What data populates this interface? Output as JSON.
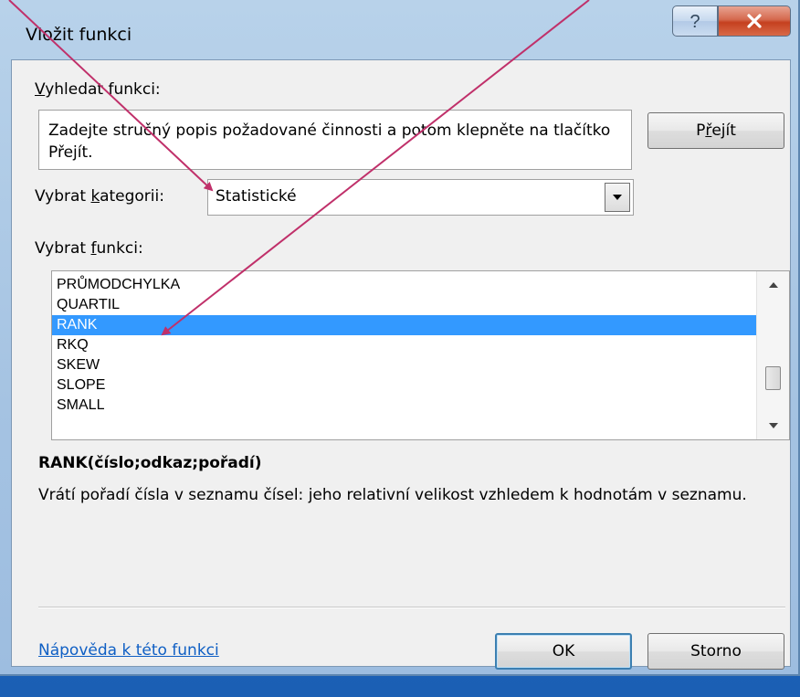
{
  "window": {
    "title": "Vložit funkci"
  },
  "search": {
    "label_underline": "V",
    "label_rest": "yhledat funkci:",
    "text": "Zadejte stručný popis požadované činnosti a potom klepněte na tlačítko Přejít.",
    "go_button": {
      "pre": "P",
      "underline": "ř",
      "rest": "ejít"
    }
  },
  "category": {
    "label_pre": "Vybrat ",
    "label_underline": "k",
    "label_rest": "ategorii:",
    "selected": "Statistické"
  },
  "function_list": {
    "label_pre": "Vybrat ",
    "label_underline": "f",
    "label_rest": "unkci:",
    "items": [
      "PRŮMODCHYLKA",
      "QUARTIL",
      "RANK",
      "RKQ",
      "SKEW",
      "SLOPE",
      "SMALL"
    ],
    "selected": "RANK"
  },
  "function_info": {
    "syntax": "RANK(číslo;odkaz;pořadí)",
    "description": "Vrátí pořadí čísla v seznamu čísel: jeho relativní velikost vzhledem k hodnotám v seznamu."
  },
  "footer": {
    "help_link": "Nápověda k této funkci",
    "ok": "OK",
    "cancel": "Storno"
  },
  "colors": {
    "selection": "#3399ff",
    "annotation_arrow": "#c0306a",
    "link": "#0f5fc4"
  }
}
